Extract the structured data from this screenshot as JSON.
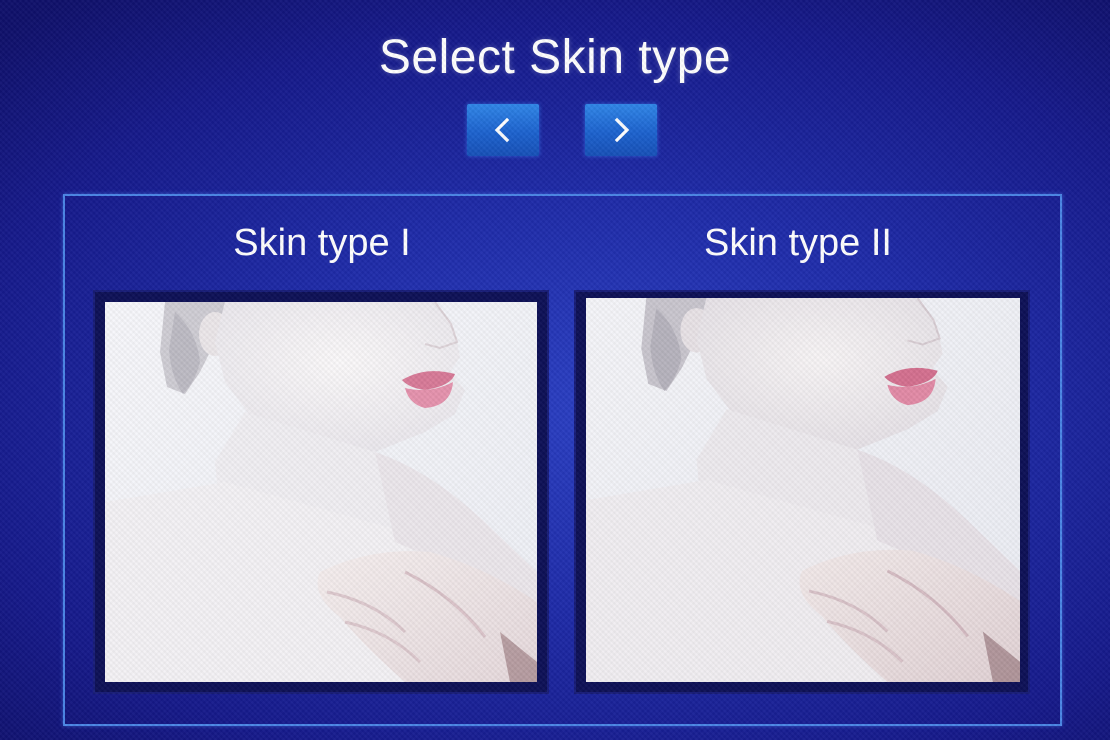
{
  "screen": {
    "title": "Select Skin type"
  },
  "navigation": {
    "prev_icon": "chevron-left-icon",
    "next_icon": "chevron-right-icon"
  },
  "cards": [
    {
      "label": "Skin type I",
      "image": "woman-portrait-fair-skin"
    },
    {
      "label": "Skin type II",
      "image": "woman-portrait-fair-skin"
    }
  ],
  "colors": {
    "background": "#1e2aa8",
    "button": "#1f68d4",
    "panel_border": "#4a86e6",
    "text": "#ffffff"
  }
}
